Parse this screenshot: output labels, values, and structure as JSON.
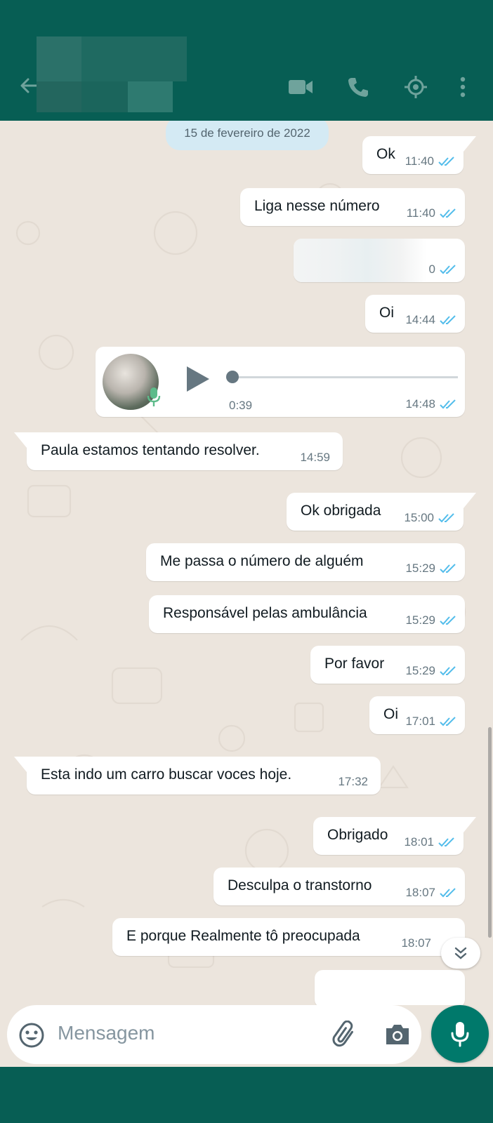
{
  "header": {
    "back_icon": "arrow-left-icon",
    "actions": [
      "video-call-icon",
      "voice-call-icon",
      "location-target-icon",
      "more-vertical-icon"
    ]
  },
  "date_divider": "15 de fevereiro de 2022",
  "messages": [
    {
      "dir": "out",
      "text": "Ok",
      "time": "11:40"
    },
    {
      "dir": "out",
      "text": "Liga nesse número",
      "time": "11:40"
    },
    {
      "dir": "out",
      "text": "",
      "time": "0",
      "redacted": true
    },
    {
      "dir": "out",
      "text": "Oi",
      "time": "14:44"
    },
    {
      "dir": "out",
      "type": "audio",
      "duration": "0:39",
      "time": "14:48"
    },
    {
      "dir": "in",
      "text": "Paula estamos tentando resolver.",
      "time": "14:59"
    },
    {
      "dir": "out",
      "text": "Ok obrigada",
      "time": "15:00"
    },
    {
      "dir": "out",
      "text": "Me passa o número de alguém",
      "time": "15:29"
    },
    {
      "dir": "out",
      "text": "Responsável pelas ambulância",
      "time": "15:29"
    },
    {
      "dir": "out",
      "text": "Por favor",
      "time": "15:29"
    },
    {
      "dir": "out",
      "text": "Oi",
      "time": "17:01"
    },
    {
      "dir": "in",
      "text": "Esta indo um carro buscar voces hoje.",
      "time": "17:32"
    },
    {
      "dir": "out",
      "text": "Obrigado",
      "time": "18:01"
    },
    {
      "dir": "out",
      "text": "Desculpa o transtorno",
      "time": "18:07"
    },
    {
      "dir": "out",
      "text": "E porque Realmente tô preocupada",
      "time": "18:07"
    }
  ],
  "composer": {
    "placeholder": "Mensagem",
    "icons": [
      "emoji-icon",
      "attach-icon",
      "camera-icon",
      "mic-icon"
    ]
  },
  "colors": {
    "header": "#075e54",
    "chat_bg": "#ece5dd",
    "read_tick": "#53bdeb",
    "mic_button": "#00796b"
  }
}
